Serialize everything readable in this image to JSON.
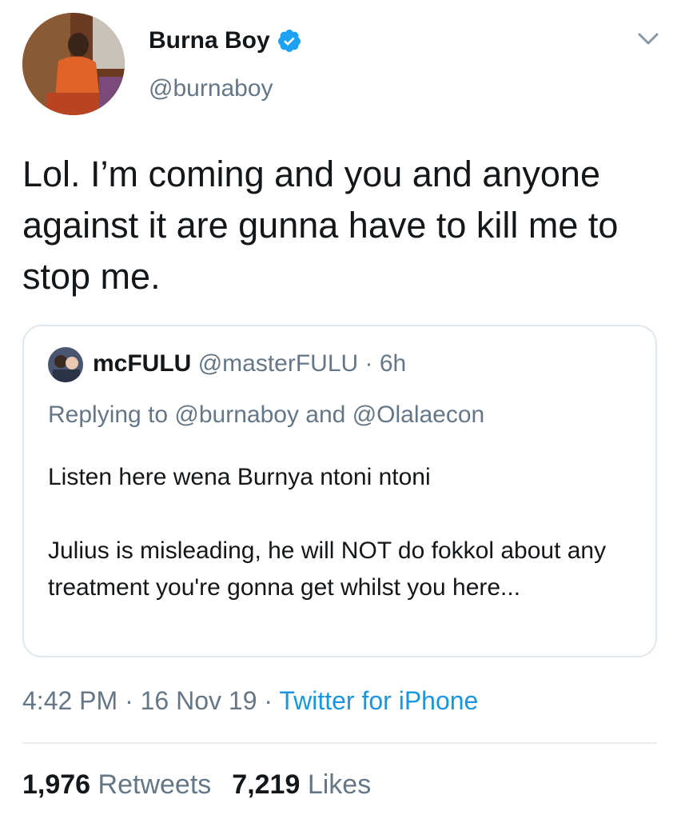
{
  "author": {
    "name": "Burna Boy",
    "handle": "@burnaboy",
    "verified": true,
    "avatar_icon": "profile-photo-orange-outfit"
  },
  "tweet": {
    "text": "Lol. I’m coming and you and anyone against it are gunna have to kill me to stop me."
  },
  "quoted_tweet": {
    "name": "mcFULU",
    "handle": "@masterFULU",
    "separator": "·",
    "time": "6h",
    "replying_to": "Replying to @burnaboy and @Olalaecon",
    "body_line1": "Listen here wena Burnya ntoni ntoni",
    "body_line2": "Julius is misleading, he will NOT do fokkol about any treatment you're gonna get whilst you here..."
  },
  "meta": {
    "time": "4:42 PM",
    "date": "16 Nov 19",
    "separator": "·",
    "source": "Twitter for iPhone"
  },
  "stats": {
    "retweets_count": "1,976",
    "retweets_label": "Retweets",
    "likes_count": "7,219",
    "likes_label": "Likes"
  },
  "colors": {
    "link": "#1b95e0",
    "secondary_text": "#657786",
    "border": "#e1e8ed"
  }
}
